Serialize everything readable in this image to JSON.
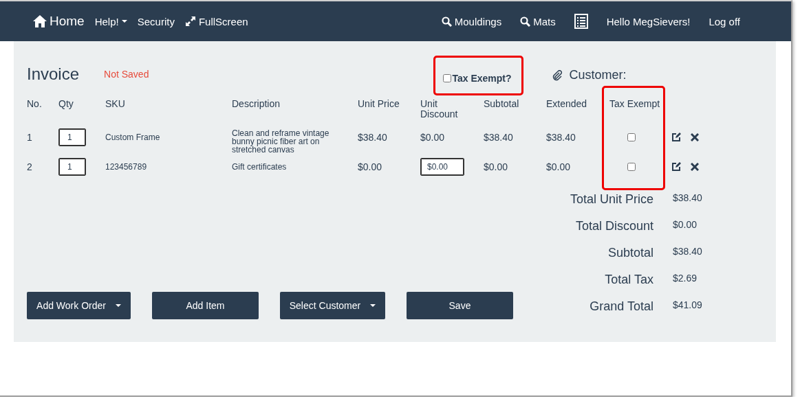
{
  "navbar": {
    "left": [
      {
        "kind": "home",
        "label": "Home"
      },
      {
        "kind": "dropdown",
        "label": "Help!"
      },
      {
        "kind": "plain",
        "label": "Security"
      },
      {
        "kind": "fullscreen",
        "label": "FullScreen"
      }
    ],
    "right": [
      {
        "kind": "search",
        "label": "Mouldings"
      },
      {
        "kind": "search",
        "label": "Mats"
      },
      {
        "kind": "list"
      },
      {
        "kind": "plain",
        "label": "Hello MegSievers!"
      },
      {
        "kind": "plain",
        "label": "Log off"
      }
    ]
  },
  "invoice": {
    "title": "Invoice",
    "status": "Not Saved",
    "tax_exempt": {
      "label": "Tax Exempt?",
      "checked": false
    },
    "customer_label": "Customer:"
  },
  "table": {
    "columns": [
      "No.",
      "Qty",
      "SKU",
      "Description",
      "Unit Price",
      "Unit Discount",
      "Subtotal",
      "Extended",
      "Tax Exempt"
    ],
    "rows": [
      {
        "no": "1",
        "qty": "1",
        "sku": "Custom Frame",
        "description": "Clean and reframe vintage bunny picnic fiber art on stretched canvas",
        "unit_price": "$38.40",
        "unit_discount": {
          "kind": "text",
          "value": "$0.00"
        },
        "subtotal": "$38.40",
        "extended": "$38.40",
        "tax_exempt": false
      },
      {
        "no": "2",
        "qty": "1",
        "sku": "123456789",
        "description": "Gift certificates",
        "unit_price": "$0.00",
        "unit_discount": {
          "kind": "input",
          "value": "$0.00"
        },
        "subtotal": "$0.00",
        "extended": "$0.00",
        "tax_exempt": false
      }
    ]
  },
  "totals": [
    {
      "label": "Total Unit Price",
      "value": "$38.40"
    },
    {
      "label": "Total Discount",
      "value": "$0.00"
    },
    {
      "label": "Subtotal",
      "value": "$38.40"
    },
    {
      "label": "Total Tax",
      "value": "$2.69"
    },
    {
      "label": "Grand Total",
      "value": "$41.09"
    }
  ],
  "buttons": [
    {
      "label": "Add Work Order",
      "dropdown": true
    },
    {
      "label": "Add Item",
      "dropdown": false
    },
    {
      "label": "Select Customer",
      "dropdown": true
    },
    {
      "label": "Save",
      "dropdown": false
    }
  ]
}
